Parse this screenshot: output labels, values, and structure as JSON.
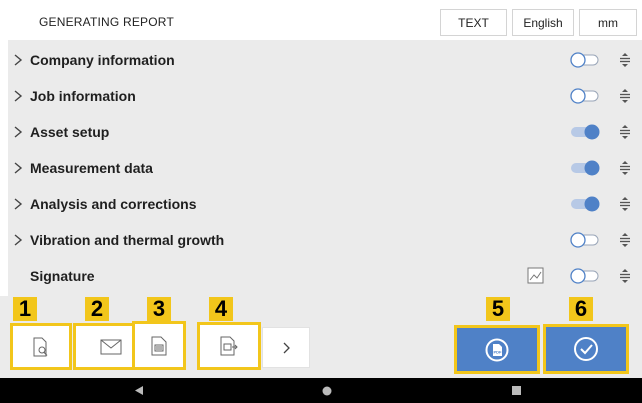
{
  "header": {
    "title": "GENERATING REPORT",
    "text_button": "TEXT",
    "language_button": "English",
    "unit_button": "mm"
  },
  "sections": [
    {
      "label": "Company information",
      "expandable": true,
      "enabled": false
    },
    {
      "label": "Job information",
      "expandable": true,
      "enabled": false
    },
    {
      "label": "Asset setup",
      "expandable": true,
      "enabled": true
    },
    {
      "label": "Measurement data",
      "expandable": true,
      "enabled": true
    },
    {
      "label": "Analysis and corrections",
      "expandable": true,
      "enabled": true
    },
    {
      "label": "Vibration and thermal growth",
      "expandable": true,
      "enabled": false
    },
    {
      "label": "Signature",
      "expandable": false,
      "enabled": false
    }
  ],
  "toolbar": {
    "badges": [
      "1",
      "2",
      "3",
      "4",
      "5",
      "6"
    ],
    "buttons": [
      "preview-icon",
      "email-icon",
      "barcode-document-icon",
      "save-document-icon",
      "chevron-right-icon",
      "pdf-icon",
      "check-icon"
    ]
  },
  "colors": {
    "accent_blue": "#4f81c7",
    "highlight_yellow": "#f2c61b",
    "panel_gray": "#ebebeb"
  }
}
